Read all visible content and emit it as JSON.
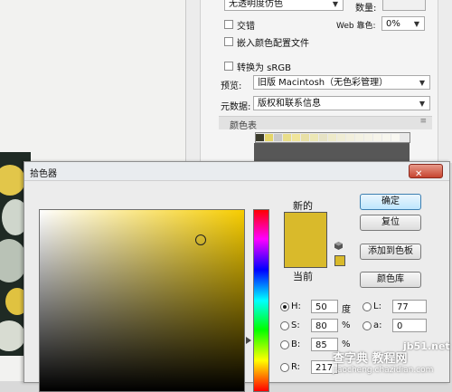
{
  "options_panel": {
    "transparency_dither": "无透明度仿色",
    "amount_label": "数量:",
    "interlaced_label": "交错",
    "web_snap_label": "Web 靠色:",
    "web_snap_value": "0%",
    "embed_profile_label": "嵌入颜色配置文件",
    "convert_srgb_label": "转换为 sRGB",
    "preview_label": "预览:",
    "preview_value": "旧版 Macintosh（无色彩管理）",
    "metadata_label": "元数据:",
    "metadata_value": "版权和联系信息",
    "color_table_label": "颜色表",
    "color_table_swatches": [
      "#3a3a2a",
      "#e4d56a",
      "#c9c9c9",
      "#e9de8a",
      "#f0e59b",
      "#e8e0a6",
      "#ece7b5",
      "#e6e2c4",
      "#eeeac9",
      "#f0edd4",
      "#f2efdc",
      "#f3f1e2",
      "#f4f2e6",
      "#f6f4ea",
      "#f7f6ee",
      "#f8f7f1"
    ]
  },
  "picker": {
    "title": "拾色器",
    "close_symbol": "✕",
    "new_label": "新的",
    "current_label": "当前",
    "new_color": "#d9ba2b",
    "current_color": "#d9ba2b",
    "hue_color": "#f7cd00",
    "buttons": {
      "ok": "确定",
      "reset": "复位",
      "add_to_swatches": "添加到色板",
      "color_libraries": "颜色库"
    },
    "hsb": [
      {
        "label": "H:",
        "value": "50",
        "unit": "度",
        "selected": true
      },
      {
        "label": "S:",
        "value": "80",
        "unit": "%",
        "selected": false
      },
      {
        "label": "B:",
        "value": "85",
        "unit": "%",
        "selected": false
      },
      {
        "label": "R:",
        "value": "217",
        "unit": "",
        "selected": false
      }
    ],
    "lab": [
      {
        "label": "L:",
        "value": "77"
      },
      {
        "label": "a:",
        "value": "0"
      }
    ]
  },
  "watermark": {
    "line1": "查字典 教程网",
    "line2": "jiaocheng.chazidian.com",
    "site": "jb51.net"
  }
}
